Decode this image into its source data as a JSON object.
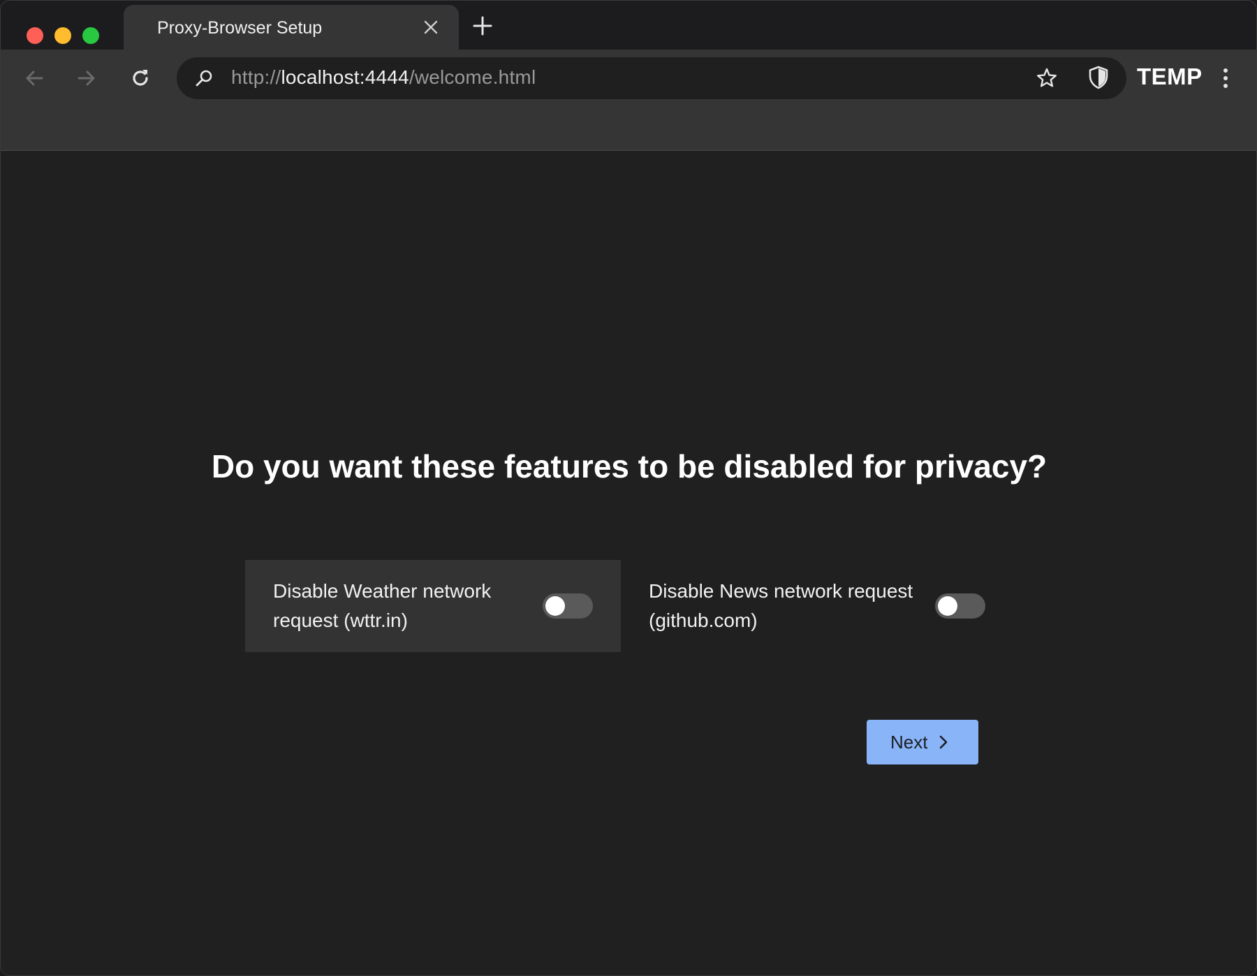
{
  "browser": {
    "tab": {
      "title": "Proxy-Browser Setup"
    },
    "address_bar": {
      "scheme": "http://",
      "host": "localhost:4444",
      "path": "/welcome.html"
    },
    "profile_label": "TEMP",
    "icons": [
      "back-arrow-icon",
      "forward-arrow-icon",
      "reload-icon",
      "search-icon",
      "star-icon",
      "shield-icon",
      "more-vertical-icon",
      "close-icon",
      "plus-icon"
    ]
  },
  "page": {
    "question": "Do you want these features to be disabled for privacy?",
    "options": [
      {
        "label": "Disable Weather network request (wttr.in)",
        "enabled": false
      },
      {
        "label": "Disable News network request (github.com)",
        "enabled": false
      }
    ],
    "next_label": "Next"
  },
  "colors": {
    "accent": "#8ab4f8",
    "background": "#202020",
    "toolbar": "#353535"
  }
}
